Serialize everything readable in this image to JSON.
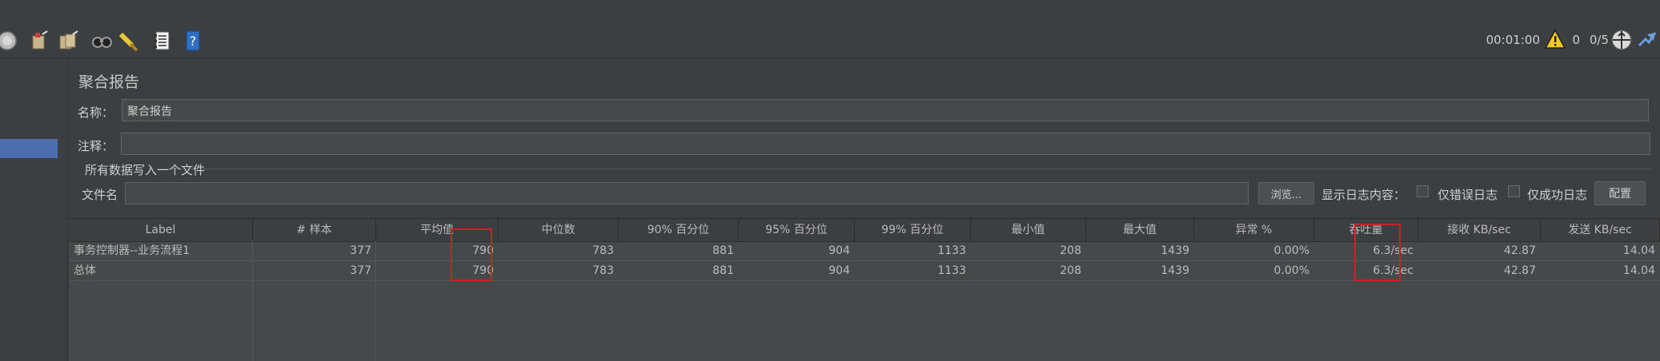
{
  "toolbar": {
    "icons": [
      "stop-icon",
      "clear-icon",
      "clear-all-icon",
      "search-icon",
      "reset-search-icon",
      "function-helper-icon",
      "help-icon"
    ],
    "timer": "00:01:00",
    "warnings": "0",
    "threads": "0/5",
    "icon_right": [
      "warning-icon",
      "remote-icon",
      "log-toggle-icon"
    ]
  },
  "main": {
    "title": "聚合报告",
    "name_label": "名称：",
    "name_value": "聚合报告",
    "comment_label": "注释：",
    "comment_value": "",
    "file_section_label": "所有数据写入一个文件",
    "filename_label": "文件名",
    "filename_value": "",
    "browse_label": "浏览...",
    "show_log_label": "显示日志内容：",
    "errors_only_label": "仅错误日志",
    "success_only_label": "仅成功日志",
    "configure_label": "配置"
  },
  "table": {
    "headers": [
      "Label",
      "# 样本",
      "平均值",
      "中位数",
      "90% 百分位",
      "95% 百分位",
      "99% 百分位",
      "最小值",
      "最大值",
      "异常 %",
      "吞吐量",
      "接收 KB/sec",
      "发送 KB/sec"
    ],
    "rows": [
      [
        "事务控制器--业务流程1",
        "377",
        "790",
        "783",
        "881",
        "904",
        "1133",
        "208",
        "1439",
        "0.00%",
        "6.3/sec",
        "42.87",
        "14.04"
      ],
      [
        "总体",
        "377",
        "790",
        "783",
        "881",
        "904",
        "1133",
        "208",
        "1439",
        "0.00%",
        "6.3/sec",
        "42.87",
        "14.04"
      ]
    ]
  },
  "colors": {
    "background": "#3c3f41",
    "field": "#45494a",
    "selection": "#4b6eaf",
    "highlight": "#d21f1f"
  }
}
